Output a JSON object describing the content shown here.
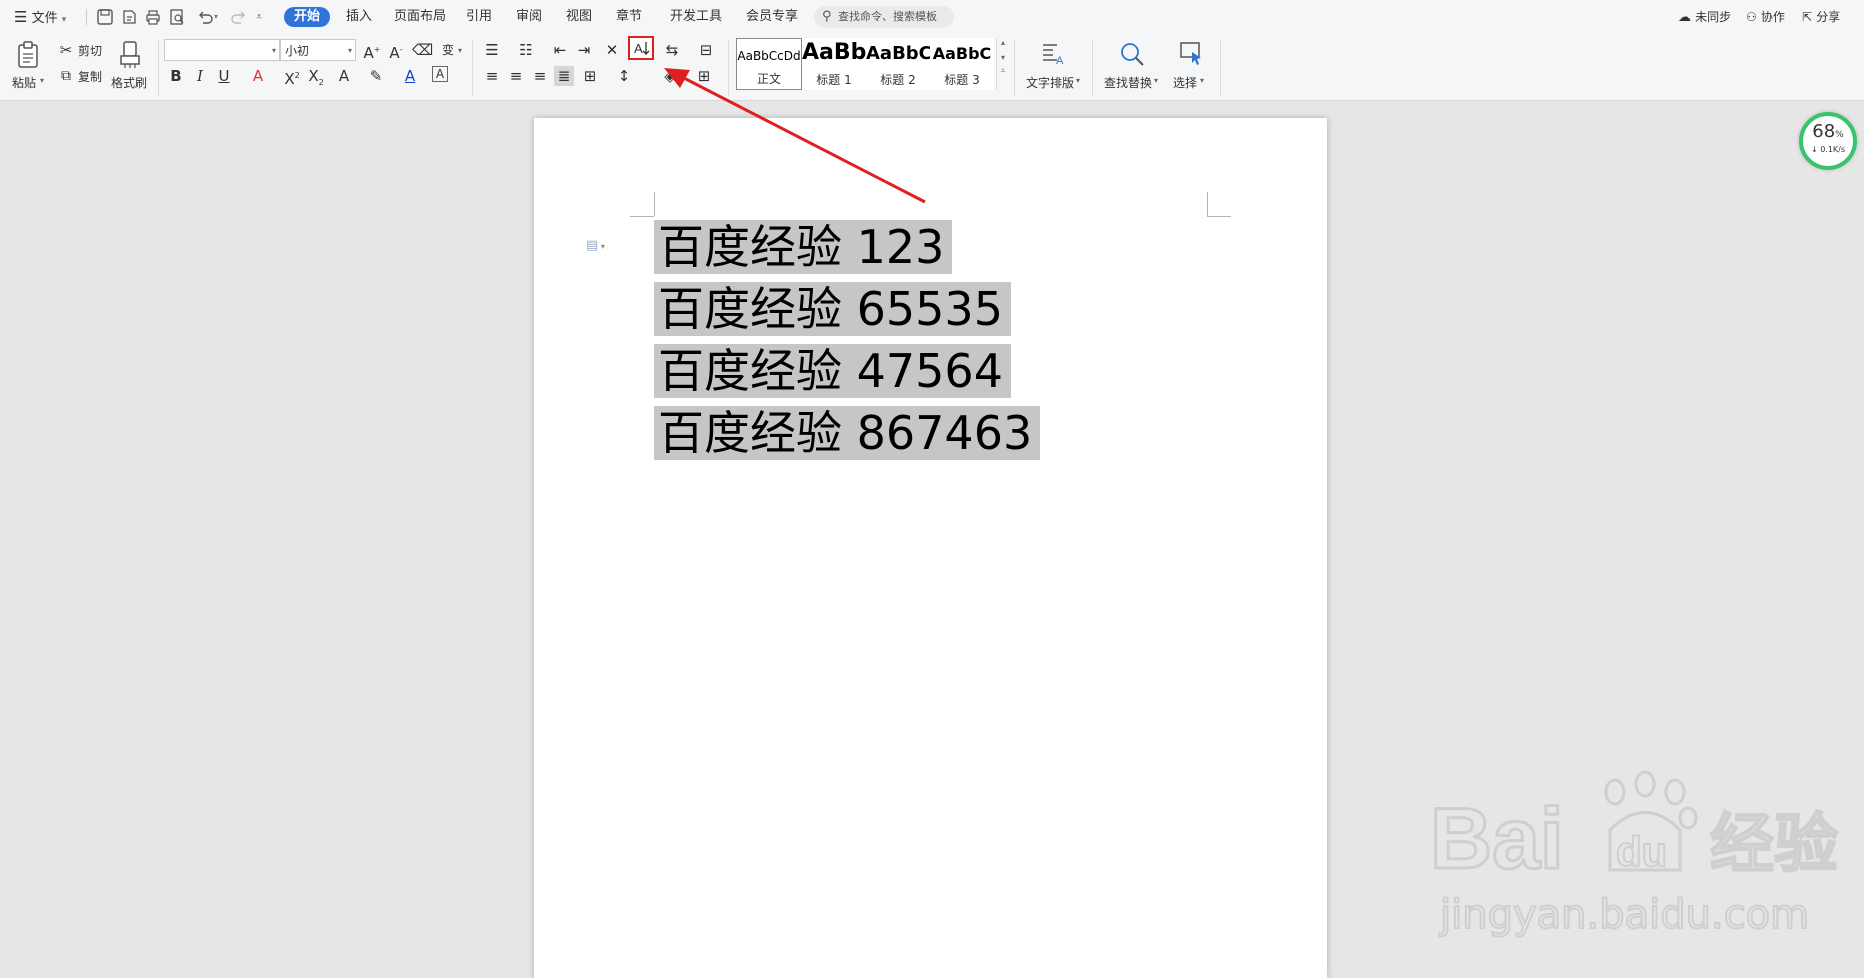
{
  "menubar": {
    "file_label": "文件",
    "tabs": [
      "开始",
      "插入",
      "页面布局",
      "引用",
      "审阅",
      "视图",
      "章节",
      "开发工具",
      "会员专享"
    ],
    "search_placeholder": "查找命令、搜索模板",
    "sync_label": "未同步",
    "collab_label": "协作",
    "share_label": "分享"
  },
  "ribbon": {
    "paste_label": "粘贴",
    "cut_label": "剪切",
    "copy_label": "复制",
    "format_painter_label": "格式刷",
    "font_name": "",
    "font_size": "小初",
    "styles": [
      {
        "sample": "AaBbCcDd",
        "name": "正文"
      },
      {
        "sample": "AaBb",
        "name": "标题 1"
      },
      {
        "sample": "AaBbC",
        "name": "标题 2"
      },
      {
        "sample": "AaBbC",
        "name": "标题 3"
      }
    ],
    "text_layout_label": "文字排版",
    "find_replace_label": "查找替换",
    "select_label": "选择"
  },
  "document": {
    "lines": [
      {
        "text": "百度经验",
        "num": "123"
      },
      {
        "text": "百度经验",
        "num": "65535"
      },
      {
        "text": "百度经验",
        "num": "47564"
      },
      {
        "text": "百度经验",
        "num": "867463"
      }
    ]
  },
  "speed_widget": {
    "value": "68",
    "unit": "%",
    "rate": "0.1K/s"
  },
  "watermark": {
    "logo": "Bai du 经验",
    "url": "jingyan.baidu.com"
  },
  "colors": {
    "accent": "#2f74d8",
    "selection": "#c6c6c6",
    "highlight_box": "#e02020",
    "arrow": "#e02020",
    "progress": "#38c46a"
  }
}
